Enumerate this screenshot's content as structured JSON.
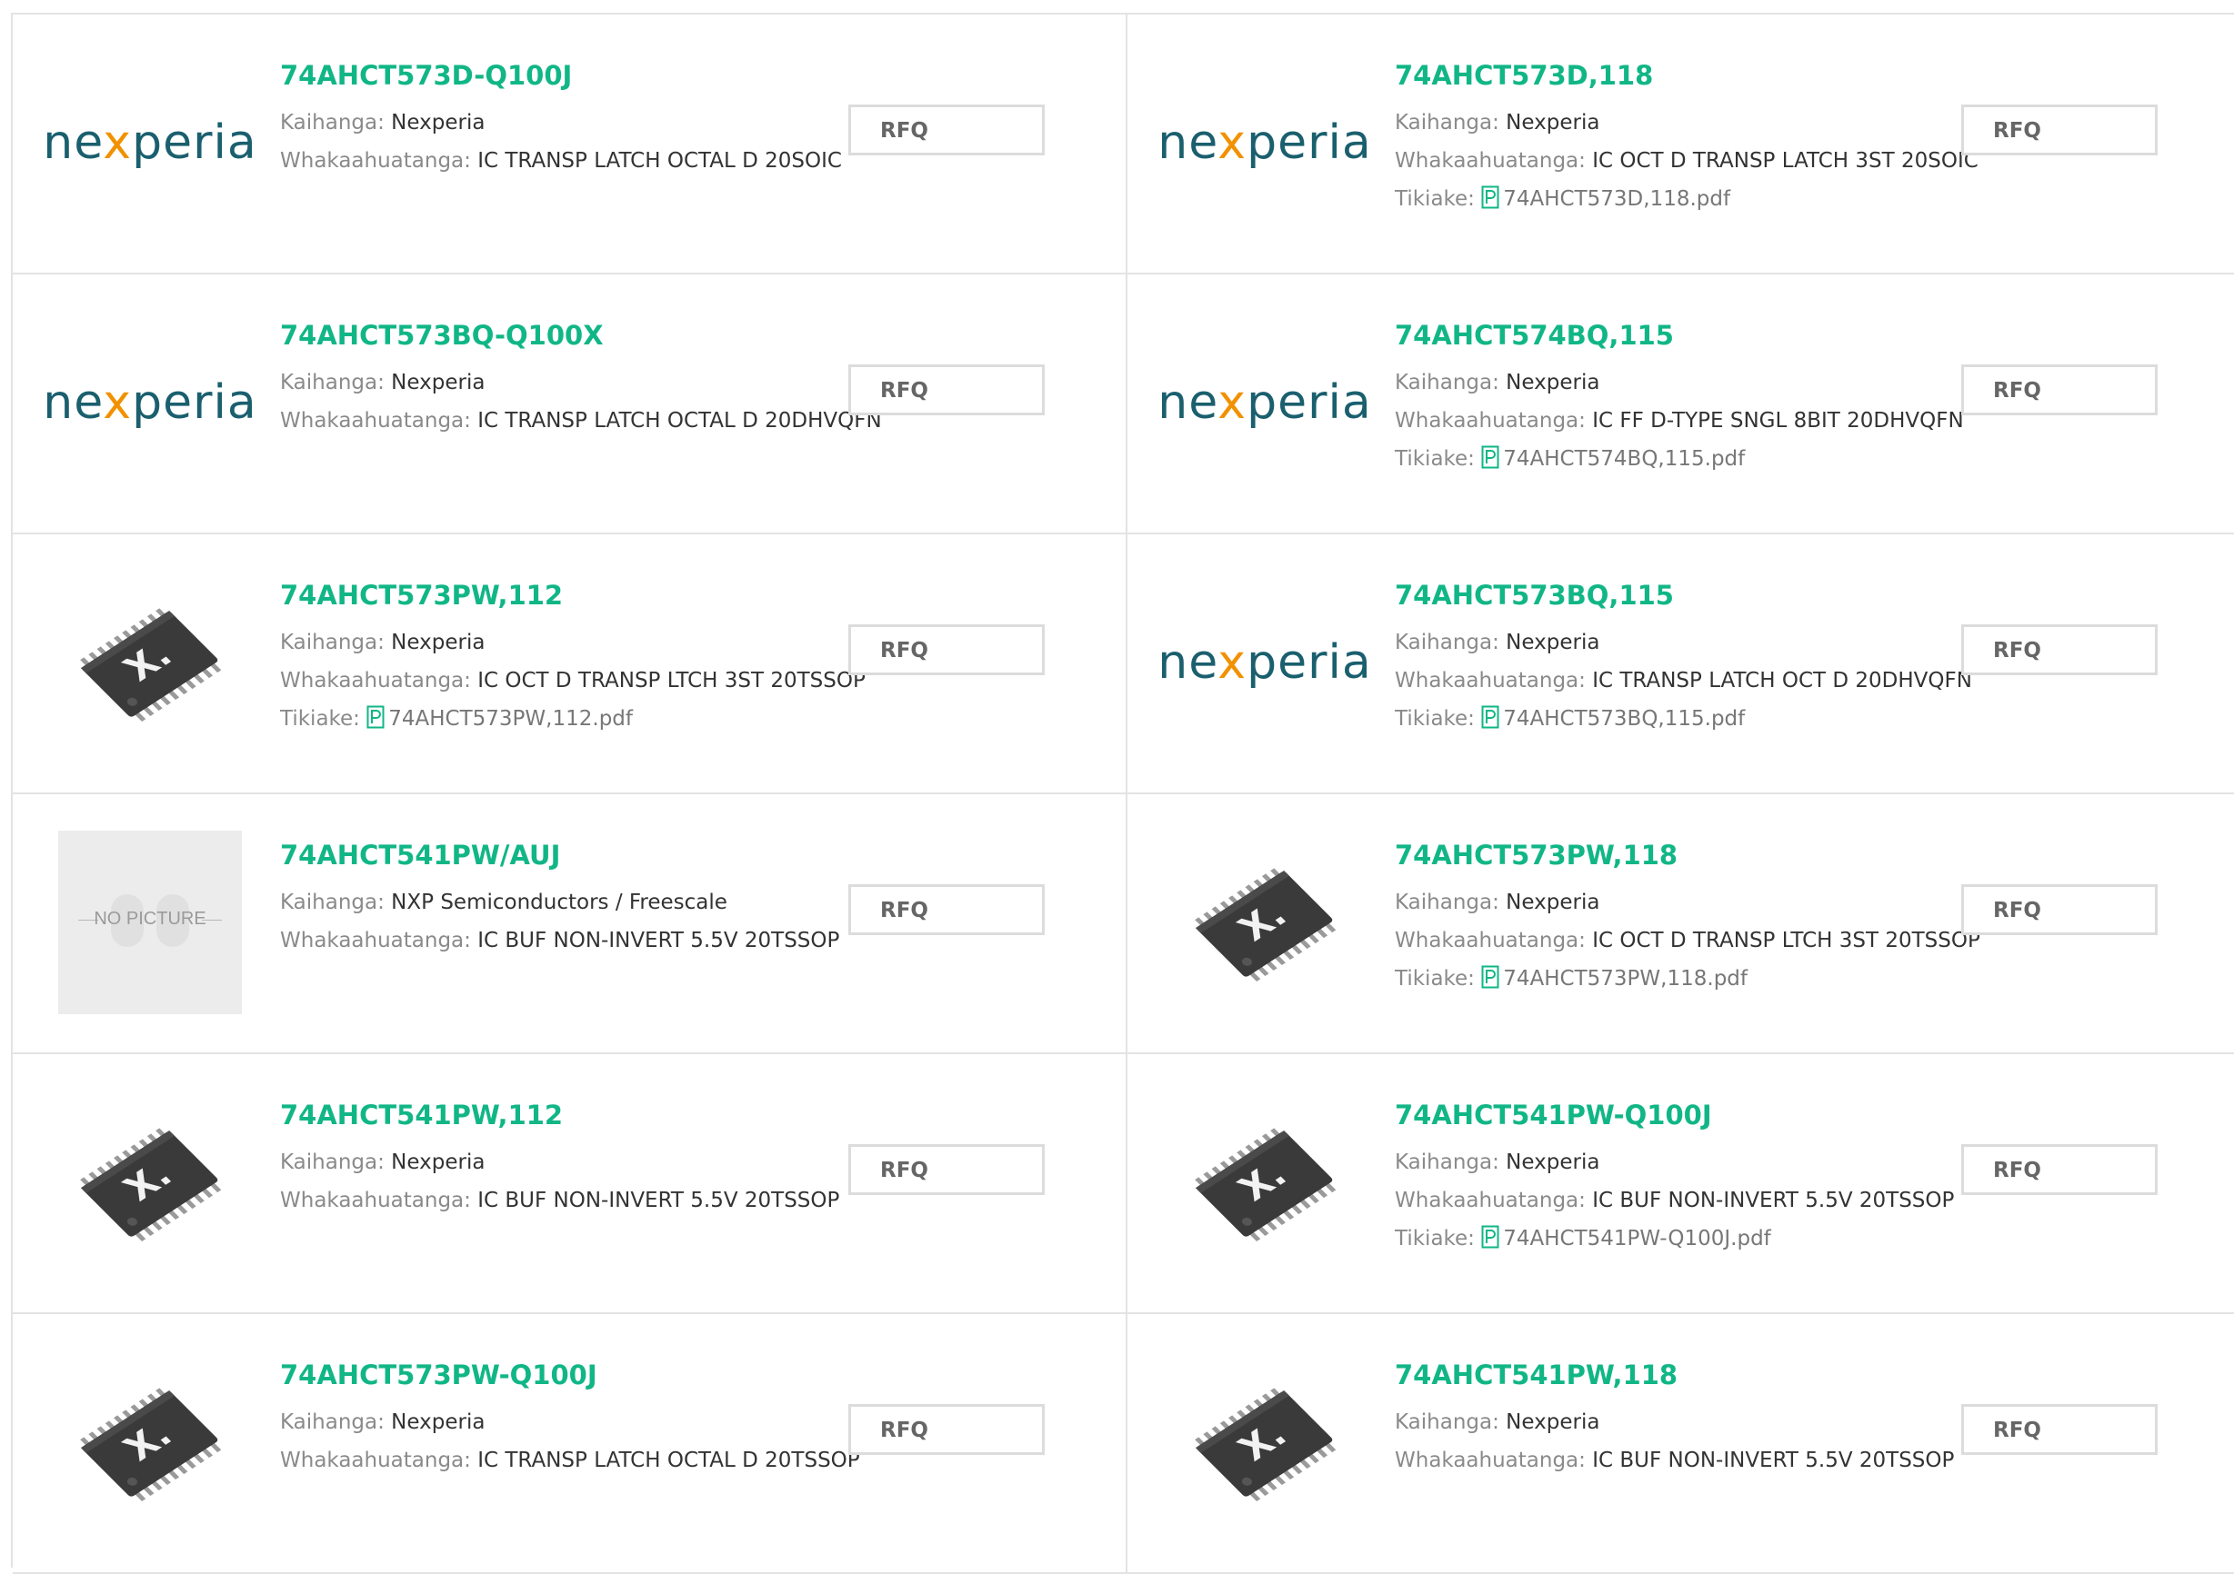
{
  "labels": {
    "manufacturer": "Kaihanga:",
    "description": "Whakaahuatanga:",
    "attachment": "Tikiake:",
    "rfq": "RFQ"
  },
  "logo": {
    "nexperia_pre": "ne",
    "nexperia_x": "x",
    "nexperia_post": "peria",
    "no_picture": "NO PICTURE"
  },
  "products": [
    {
      "part": "74AHCT573D-Q100J",
      "image": "nexperia-logo",
      "manufacturer": "Nexperia",
      "description": "IC TRANSP LATCH OCTAL D 20SOIC",
      "pdf": ""
    },
    {
      "part": "74AHCT573D,118",
      "image": "nexperia-logo",
      "manufacturer": "Nexperia",
      "description": "IC OCT D TRANSP LATCH 3ST 20SOIC",
      "pdf": "74AHCT573D,118.pdf"
    },
    {
      "part": "74AHCT573BQ-Q100X",
      "image": "nexperia-logo",
      "manufacturer": "Nexperia",
      "description": "IC TRANSP LATCH OCTAL D 20DHVQFN",
      "pdf": ""
    },
    {
      "part": "74AHCT574BQ,115",
      "image": "nexperia-logo",
      "manufacturer": "Nexperia",
      "description": "IC FF D-TYPE SNGL 8BIT 20DHVQFN",
      "pdf": "74AHCT574BQ,115.pdf"
    },
    {
      "part": "74AHCT573PW,112",
      "image": "chip-photo",
      "manufacturer": "Nexperia",
      "description": "IC OCT D TRANSP LTCH 3ST 20TSSOP",
      "pdf": "74AHCT573PW,112.pdf"
    },
    {
      "part": "74AHCT573BQ,115",
      "image": "nexperia-logo",
      "manufacturer": "Nexperia",
      "description": "IC TRANSP LATCH OCT D 20DHVQFN",
      "pdf": "74AHCT573BQ,115.pdf"
    },
    {
      "part": "74AHCT541PW/AUJ",
      "image": "no-picture",
      "manufacturer": "NXP Semiconductors / Freescale",
      "description": "IC BUF NON-INVERT 5.5V 20TSSOP",
      "pdf": ""
    },
    {
      "part": "74AHCT573PW,118",
      "image": "chip-photo",
      "manufacturer": "Nexperia",
      "description": "IC OCT D TRANSP LTCH 3ST 20TSSOP",
      "pdf": "74AHCT573PW,118.pdf"
    },
    {
      "part": "74AHCT541PW,112",
      "image": "chip-photo",
      "manufacturer": "Nexperia",
      "description": "IC BUF NON-INVERT 5.5V 20TSSOP",
      "pdf": ""
    },
    {
      "part": "74AHCT541PW-Q100J",
      "image": "chip-photo",
      "manufacturer": "Nexperia",
      "description": "IC BUF NON-INVERT 5.5V 20TSSOP",
      "pdf": "74AHCT541PW-Q100J.pdf"
    },
    {
      "part": "74AHCT573PW-Q100J",
      "image": "chip-photo",
      "manufacturer": "Nexperia",
      "description": "IC TRANSP LATCH OCTAL D 20TSSOP",
      "pdf": ""
    },
    {
      "part": "74AHCT541PW,118",
      "image": "chip-photo",
      "manufacturer": "Nexperia",
      "description": "IC BUF NON-INVERT 5.5V 20TSSOP",
      "pdf": ""
    }
  ],
  "colors": {
    "accent": "#11b686",
    "border": "#e3e3e3",
    "nexperia_teal": "#1a5f6e",
    "nexperia_orange": "#f29100"
  }
}
